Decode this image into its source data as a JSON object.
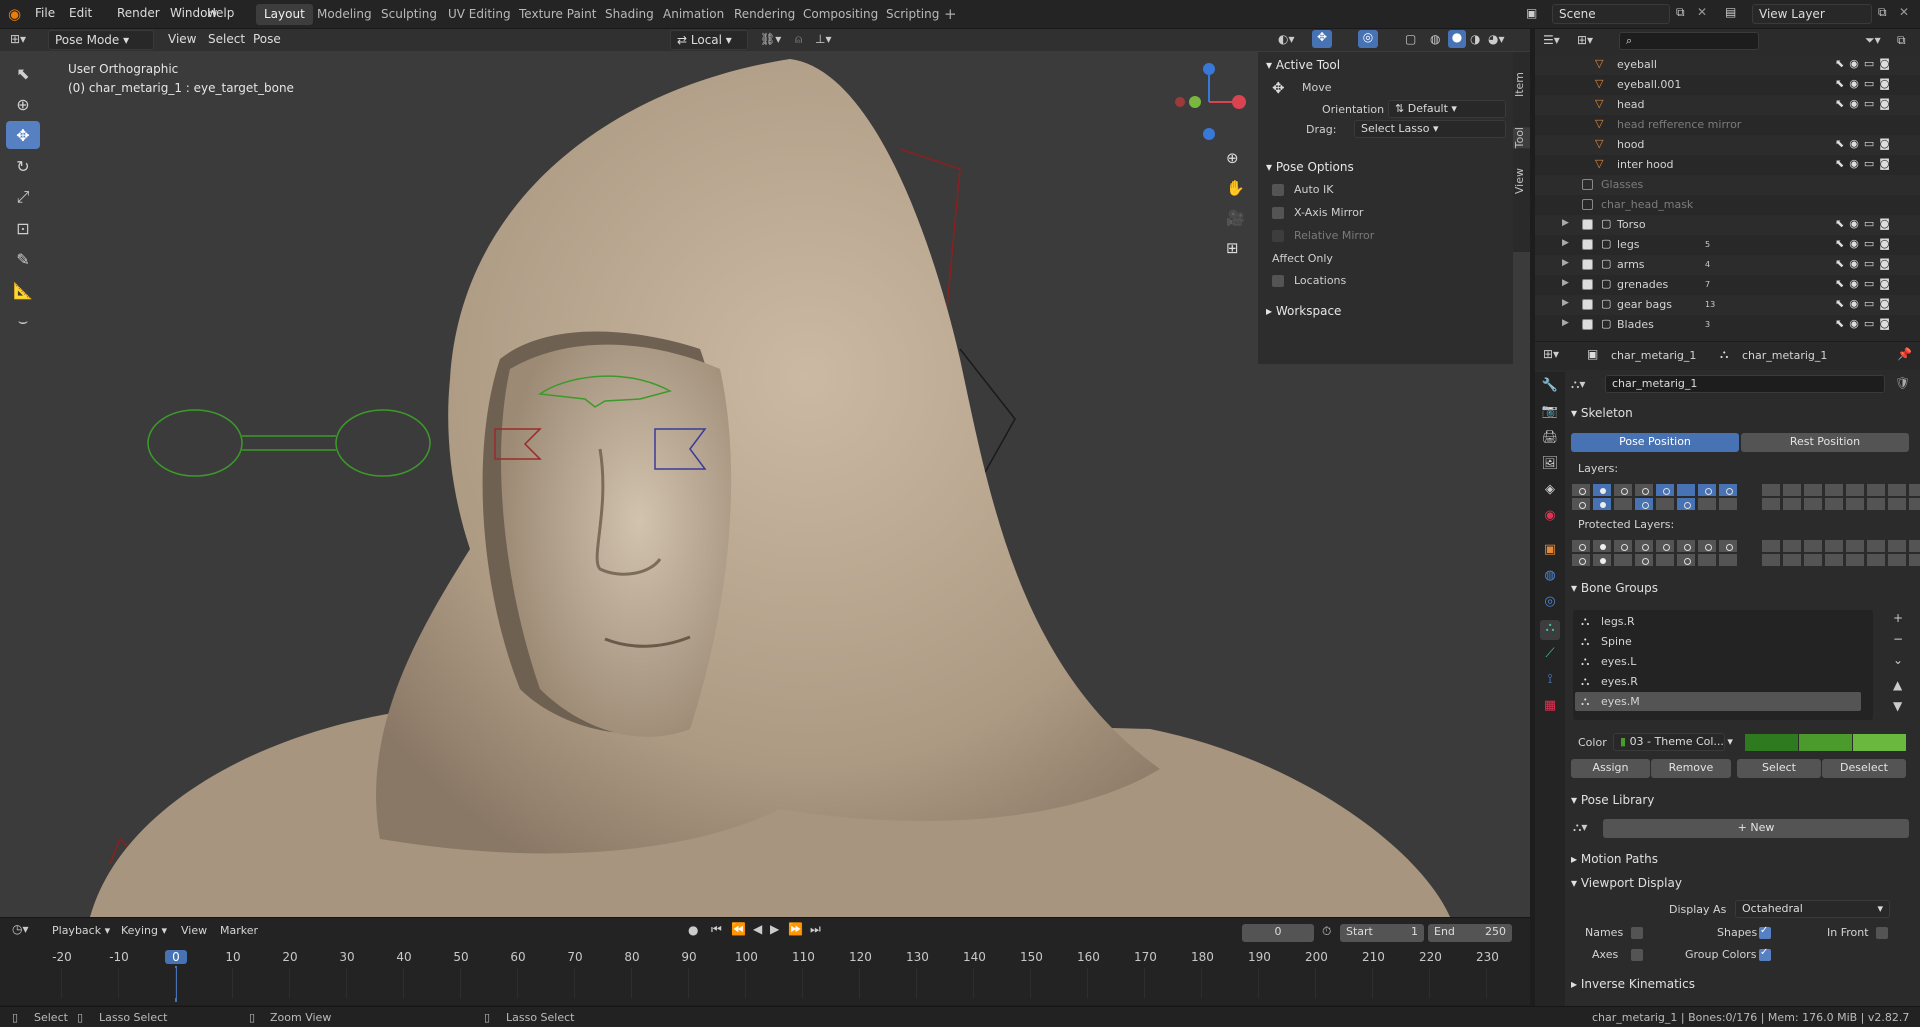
{
  "topbar": {
    "menus": [
      "File",
      "Edit",
      "Render",
      "Window",
      "Help"
    ],
    "workspaces": [
      "Layout",
      "Modeling",
      "Sculpting",
      "UV Editing",
      "Texture Paint",
      "Shading",
      "Animation",
      "Rendering",
      "Compositing",
      "Scripting"
    ],
    "active_workspace": "Layout",
    "scene": "Scene",
    "view_layer": "View Layer"
  },
  "viewport": {
    "mode": "Pose Mode",
    "menus": [
      "View",
      "Select",
      "Pose"
    ],
    "transform_orientation": "Local",
    "info_line1": "User Orthographic",
    "info_line2": "(0) char_metarig_1 : eye_target_bone"
  },
  "tool_panel": {
    "active_tool_header": "Active Tool",
    "tool_name": "Move",
    "orientation_label": "Orientation",
    "orientation_value": "Default",
    "drag_label": "Drag:",
    "drag_value": "Select Lasso",
    "pose_options_header": "Pose Options",
    "auto_ik": "Auto IK",
    "x_axis_mirror": "X-Axis Mirror",
    "relative_mirror": "Relative Mirror",
    "affect_only": "Affect Only",
    "locations": "Locations",
    "workspace": "Workspace",
    "tabs": [
      "Item",
      "Tool",
      "View"
    ]
  },
  "outliner": {
    "rows": [
      {
        "name": "eyeball",
        "dim": false,
        "indent": 1
      },
      {
        "name": "eyeball.001",
        "dim": false,
        "indent": 1
      },
      {
        "name": "head",
        "dim": false,
        "indent": 1
      },
      {
        "name": "head refference mirror",
        "dim": true,
        "indent": 1
      },
      {
        "name": "hood",
        "dim": false,
        "indent": 1
      },
      {
        "name": "inter hood",
        "dim": false,
        "indent": 1
      },
      {
        "name": "Glasses",
        "dim": true,
        "indent": 0
      },
      {
        "name": "char_head_mask",
        "dim": true,
        "indent": 0
      },
      {
        "name": "Torso",
        "dim": false,
        "indent": 0,
        "badge": ""
      },
      {
        "name": "legs",
        "dim": false,
        "indent": 0,
        "badge": "5"
      },
      {
        "name": "arms",
        "dim": false,
        "indent": 0,
        "badge": "4"
      },
      {
        "name": "grenades",
        "dim": false,
        "indent": 0,
        "badge": "7"
      },
      {
        "name": "gear bags",
        "dim": false,
        "indent": 0,
        "badge": "13"
      },
      {
        "name": "Blades",
        "dim": false,
        "indent": 0,
        "badge": "3"
      }
    ]
  },
  "properties": {
    "breadcrumb1": "char_metarig_1",
    "breadcrumb2": "char_metarig_1",
    "data_name": "char_metarig_1",
    "skeleton": "Skeleton",
    "pose_position": "Pose Position",
    "rest_position": "Rest Position",
    "layers": "Layers:",
    "protected_layers": "Protected Layers:",
    "bone_groups": "Bone Groups",
    "groups": [
      "legs.R",
      "Spine",
      "eyes.L",
      "eyes.R",
      "eyes.M"
    ],
    "selected_group": "eyes.M",
    "color_label": "Color",
    "color_value": "03 - Theme Col...",
    "assign": "Assign",
    "remove": "Remove",
    "select": "Select",
    "deselect": "Deselect",
    "pose_library": "Pose Library",
    "new": "New",
    "motion_paths": "Motion Paths",
    "viewport_display": "Viewport Display",
    "display_as_label": "Display As",
    "display_as_value": "Octahedral",
    "names": "Names",
    "in_front": "In Front",
    "axes": "Axes",
    "shapes": "Shapes",
    "group_colors": "Group Colors",
    "inverse_kinematics": "Inverse Kinematics"
  },
  "timeline": {
    "menus": [
      "Playback",
      "Keying",
      "View",
      "Marker"
    ],
    "current_frame": "0",
    "start_label": "Start",
    "start": "1",
    "end_label": "End",
    "end": "250",
    "ticks": [
      "-20",
      "-10",
      "0",
      "10",
      "20",
      "30",
      "40",
      "50",
      "60",
      "70",
      "80",
      "90",
      "100",
      "110",
      "120",
      "130",
      "140",
      "150",
      "160",
      "170",
      "180",
      "190",
      "200",
      "210",
      "220",
      "230"
    ]
  },
  "statusbar": {
    "select": "Select",
    "lasso_select": "Lasso Select",
    "zoom_view": "Zoom View",
    "lasso_select2": "Lasso Select",
    "info": "char_metarig_1 | Bones:0/176 | Mem: 176.0 MiB | v2.82.7"
  },
  "colors": {
    "accent": "#4772b3",
    "active_tool": "#5680c2",
    "group_color_1": "#2e7a1f",
    "group_color_2": "#4a9a2c",
    "group_color_3": "#6bb83e",
    "icon_orange": "#e1893a",
    "icon_teal": "#39c1a9"
  }
}
